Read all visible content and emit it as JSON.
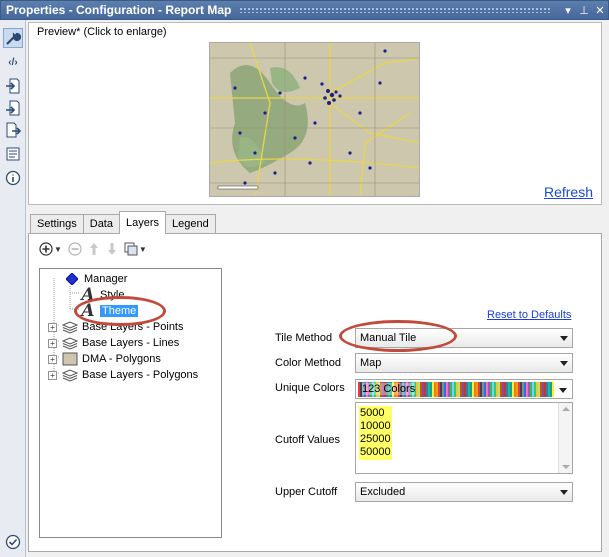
{
  "window": {
    "title": "Properties - Configuration - Report Map",
    "controls": [
      "▾",
      "⊥",
      "✕"
    ]
  },
  "sidebar": {
    "icons": [
      "wrench-icon",
      "code-icon",
      "input-icon",
      "output-icon",
      "export-icon",
      "annotation-icon",
      "info-icon",
      "check-icon"
    ]
  },
  "preview": {
    "label": "Preview* (Click to enlarge)",
    "refresh": "Refresh"
  },
  "tabs": [
    {
      "label": "Settings",
      "active": false
    },
    {
      "label": "Data",
      "active": false
    },
    {
      "label": "Layers",
      "active": true
    },
    {
      "label": "Legend",
      "active": false
    }
  ],
  "tree": {
    "items": [
      {
        "label": "Manager",
        "icon": "diamond-icon"
      },
      {
        "label": "Style",
        "icon": "style-a-icon"
      },
      {
        "label": "Theme",
        "icon": "theme-a-icon",
        "selected": true
      },
      {
        "label": "Base Layers - Points",
        "icon": "layers-icon"
      },
      {
        "label": "Base Layers - Lines",
        "icon": "layers-icon"
      },
      {
        "label": "DMA - Polygons",
        "icon": "polygon-icon"
      },
      {
        "label": "Base Layers - Polygons",
        "icon": "layers-icon"
      }
    ]
  },
  "form": {
    "reset_label": "Reset to Defaults",
    "tile_method_label": "Tile Method",
    "tile_method_value": "Manual Tile",
    "color_method_label": "Color Method",
    "color_method_value": "Map",
    "unique_colors_label": "Unique Colors",
    "unique_colors_value": "123 Colors",
    "cutoff_values_label": "Cutoff Values",
    "cutoff_values": [
      "5000",
      "10000",
      "25000",
      "50000"
    ],
    "upper_cutoff_label": "Upper Cutoff",
    "upper_cutoff_value": "Excluded"
  },
  "colors": {
    "highlight_ellipse": "#c14a3a",
    "selection": "#3399ff",
    "link": "#1a4bd6",
    "cutoff_highlight": "#ffff66"
  }
}
